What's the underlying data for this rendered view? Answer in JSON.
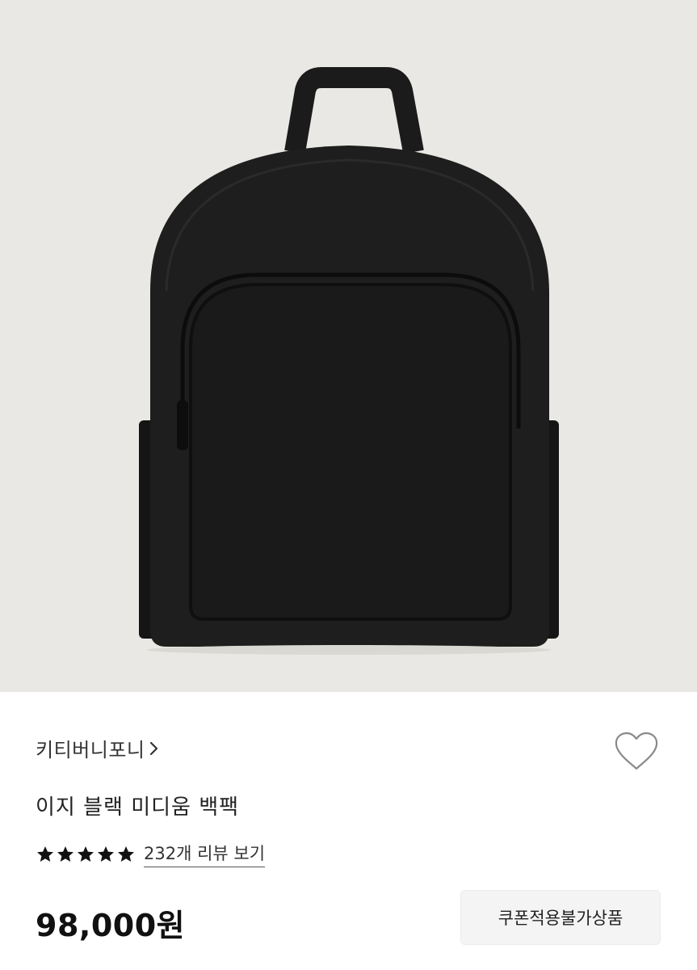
{
  "product": {
    "brand": "키티버니포니",
    "name": "이지 블랙 미디움 백팩",
    "rating_stars": 5,
    "review_link": "232개 리뷰 보기",
    "price": "98,000원",
    "coupon_badge": "쿠폰적용불가상품"
  },
  "icons": {
    "brand_chevron": "chevron-right-icon",
    "wishlist": "heart-outline-icon",
    "star": "star-filled-icon"
  },
  "colors": {
    "hero_background": "#e9e8e4",
    "bag": "#1c1c1c",
    "badge_background": "#f4f4f4"
  }
}
